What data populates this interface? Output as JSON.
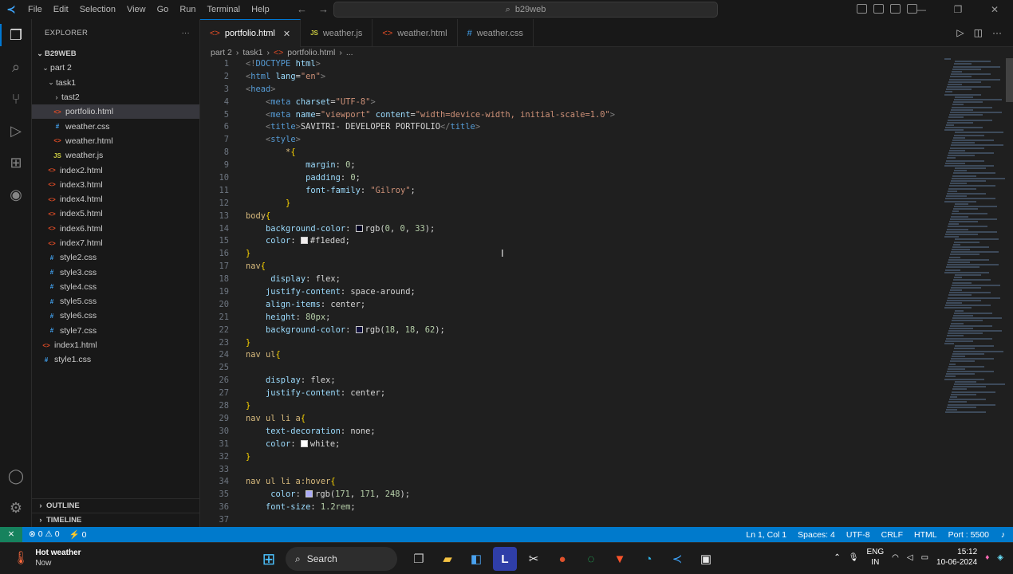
{
  "titlebar": {
    "menu": [
      "File",
      "Edit",
      "Selection",
      "View",
      "Go",
      "Run",
      "Terminal",
      "Help"
    ],
    "search": "b29web"
  },
  "explorer": {
    "title": "EXPLORER",
    "root": "B29WEB",
    "items": [
      {
        "label": "part 2",
        "depth": 1,
        "kind": "folder",
        "open": true
      },
      {
        "label": "task1",
        "depth": 2,
        "kind": "folder",
        "open": true
      },
      {
        "label": "tast2",
        "depth": 3,
        "kind": "folder",
        "open": false
      },
      {
        "label": "portfolio.html",
        "depth": 3,
        "kind": "html",
        "selected": true
      },
      {
        "label": "weather.css",
        "depth": 3,
        "kind": "css"
      },
      {
        "label": "weather.html",
        "depth": 3,
        "kind": "html"
      },
      {
        "label": "weather.js",
        "depth": 3,
        "kind": "js"
      },
      {
        "label": "index2.html",
        "depth": 2,
        "kind": "html"
      },
      {
        "label": "index3.html",
        "depth": 2,
        "kind": "html"
      },
      {
        "label": "index4.html",
        "depth": 2,
        "kind": "html"
      },
      {
        "label": "index5.html",
        "depth": 2,
        "kind": "html"
      },
      {
        "label": "index6.html",
        "depth": 2,
        "kind": "html"
      },
      {
        "label": "index7.html",
        "depth": 2,
        "kind": "html"
      },
      {
        "label": "style2.css",
        "depth": 2,
        "kind": "css"
      },
      {
        "label": "style3.css",
        "depth": 2,
        "kind": "css"
      },
      {
        "label": "style4.css",
        "depth": 2,
        "kind": "css"
      },
      {
        "label": "style5.css",
        "depth": 2,
        "kind": "css"
      },
      {
        "label": "style6.css",
        "depth": 2,
        "kind": "css"
      },
      {
        "label": "style7.css",
        "depth": 2,
        "kind": "css"
      },
      {
        "label": "index1.html",
        "depth": 1,
        "kind": "html"
      },
      {
        "label": "style1.css",
        "depth": 1,
        "kind": "css"
      }
    ],
    "outline": "OUTLINE",
    "timeline": "TIMELINE"
  },
  "tabs": [
    {
      "label": "portfolio.html",
      "kind": "html",
      "active": true
    },
    {
      "label": "weather.js",
      "kind": "js"
    },
    {
      "label": "weather.html",
      "kind": "html"
    },
    {
      "label": "weather.css",
      "kind": "css"
    }
  ],
  "breadcrumb": [
    "part 2",
    "task1",
    "portfolio.html",
    "..."
  ],
  "code": [
    [
      [
        "t-punc",
        "<!"
      ],
      [
        "t-tag",
        "DOCTYPE "
      ],
      [
        "t-attr",
        "html"
      ],
      [
        "t-punc",
        ">"
      ]
    ],
    [
      [
        "t-punc",
        "<"
      ],
      [
        "t-tag",
        "html "
      ],
      [
        "t-attr",
        "lang"
      ],
      [
        "t-txt",
        "="
      ],
      [
        "t-str",
        "\"en\""
      ],
      [
        "t-punc",
        ">"
      ]
    ],
    [
      [
        "t-punc",
        "<"
      ],
      [
        "t-tag",
        "head"
      ],
      [
        "t-punc",
        ">"
      ]
    ],
    [
      [
        "t-txt",
        "    "
      ],
      [
        "t-punc",
        "<"
      ],
      [
        "t-tag",
        "meta "
      ],
      [
        "t-attr",
        "charset"
      ],
      [
        "t-txt",
        "="
      ],
      [
        "t-str",
        "\"UTF-8\""
      ],
      [
        "t-punc",
        ">"
      ]
    ],
    [
      [
        "t-txt",
        "    "
      ],
      [
        "t-punc",
        "<"
      ],
      [
        "t-tag",
        "meta "
      ],
      [
        "t-attr",
        "name"
      ],
      [
        "t-txt",
        "="
      ],
      [
        "t-str",
        "\"viewport\" "
      ],
      [
        "t-attr",
        "content"
      ],
      [
        "t-txt",
        "="
      ],
      [
        "t-str",
        "\"width=device-width, initial-scale=1.0\""
      ],
      [
        "t-punc",
        ">"
      ]
    ],
    [
      [
        "t-txt",
        "    "
      ],
      [
        "t-punc",
        "<"
      ],
      [
        "t-tag",
        "title"
      ],
      [
        "t-punc",
        ">"
      ],
      [
        "t-txt",
        "SAVITRI- DEVELOPER PORTFOLIO"
      ],
      [
        "t-punc",
        "</"
      ],
      [
        "t-tag",
        "title"
      ],
      [
        "t-punc",
        ">"
      ]
    ],
    [
      [
        "t-txt",
        "    "
      ],
      [
        "t-punc",
        "<"
      ],
      [
        "t-tag",
        "style"
      ],
      [
        "t-punc",
        ">"
      ]
    ],
    [
      [
        "t-txt",
        "        "
      ],
      [
        "t-sel",
        "*"
      ],
      [
        "t-brk",
        "{"
      ]
    ],
    [
      [
        "t-txt",
        "            "
      ],
      [
        "t-prop",
        "margin"
      ],
      [
        "t-txt",
        ": "
      ],
      [
        "t-num",
        "0"
      ],
      [
        "t-txt",
        ";"
      ]
    ],
    [
      [
        "t-txt",
        "            "
      ],
      [
        "t-prop",
        "padding"
      ],
      [
        "t-txt",
        ": "
      ],
      [
        "t-num",
        "0"
      ],
      [
        "t-txt",
        ";"
      ]
    ],
    [
      [
        "t-txt",
        "            "
      ],
      [
        "t-prop",
        "font-family"
      ],
      [
        "t-txt",
        ": "
      ],
      [
        "t-val",
        "\"Gilroy\""
      ],
      [
        "t-txt",
        ";"
      ]
    ],
    [
      [
        "t-txt",
        "        "
      ],
      [
        "t-brk",
        "}"
      ]
    ],
    [
      [
        "t-sel",
        "body"
      ],
      [
        "t-brk",
        "{"
      ]
    ],
    [
      [
        "t-txt",
        "    "
      ],
      [
        "t-prop",
        "background-color"
      ],
      [
        "t-txt",
        ": "
      ],
      [
        "sw",
        "#000021"
      ],
      [
        "t-txt",
        "rgb("
      ],
      [
        "t-num",
        "0"
      ],
      [
        "t-txt",
        ", "
      ],
      [
        "t-num",
        "0"
      ],
      [
        "t-txt",
        ", "
      ],
      [
        "t-num",
        "33"
      ],
      [
        "t-txt",
        ");"
      ]
    ],
    [
      [
        "t-txt",
        "    "
      ],
      [
        "t-prop",
        "color"
      ],
      [
        "t-txt",
        ": "
      ],
      [
        "sw",
        "#f1eded"
      ],
      [
        "t-txt",
        "#f1eded;"
      ]
    ],
    [
      [
        "t-brk",
        "}"
      ]
    ],
    [
      [
        "t-sel",
        "nav"
      ],
      [
        "t-brk",
        "{"
      ]
    ],
    [
      [
        "t-txt",
        "     "
      ],
      [
        "t-prop",
        "display"
      ],
      [
        "t-txt",
        ": "
      ],
      [
        "t-txt",
        "flex;"
      ]
    ],
    [
      [
        "t-txt",
        "    "
      ],
      [
        "t-prop",
        "justify-content"
      ],
      [
        "t-txt",
        ": "
      ],
      [
        "t-txt",
        "space-around;"
      ]
    ],
    [
      [
        "t-txt",
        "    "
      ],
      [
        "t-prop",
        "align-items"
      ],
      [
        "t-txt",
        ": "
      ],
      [
        "t-txt",
        "center;"
      ]
    ],
    [
      [
        "t-txt",
        "    "
      ],
      [
        "t-prop",
        "height"
      ],
      [
        "t-txt",
        ": "
      ],
      [
        "t-num",
        "80px"
      ],
      [
        "t-txt",
        ";"
      ]
    ],
    [
      [
        "t-txt",
        "    "
      ],
      [
        "t-prop",
        "background-color"
      ],
      [
        "t-txt",
        ": "
      ],
      [
        "sw",
        "#12123e"
      ],
      [
        "t-txt",
        "rgb("
      ],
      [
        "t-num",
        "18"
      ],
      [
        "t-txt",
        ", "
      ],
      [
        "t-num",
        "18"
      ],
      [
        "t-txt",
        ", "
      ],
      [
        "t-num",
        "62"
      ],
      [
        "t-txt",
        ");"
      ]
    ],
    [
      [
        "t-brk",
        "}"
      ]
    ],
    [
      [
        "t-sel",
        "nav ul"
      ],
      [
        "t-brk",
        "{"
      ]
    ],
    [
      [
        "t-txt",
        ""
      ]
    ],
    [
      [
        "t-txt",
        "    "
      ],
      [
        "t-prop",
        "display"
      ],
      [
        "t-txt",
        ": "
      ],
      [
        "t-txt",
        "flex;"
      ]
    ],
    [
      [
        "t-txt",
        "    "
      ],
      [
        "t-prop",
        "justify-content"
      ],
      [
        "t-txt",
        ": "
      ],
      [
        "t-txt",
        "center;"
      ]
    ],
    [
      [
        "t-brk",
        "}"
      ]
    ],
    [
      [
        "t-sel",
        "nav ul li a"
      ],
      [
        "t-brk",
        "{"
      ]
    ],
    [
      [
        "t-txt",
        "    "
      ],
      [
        "t-prop",
        "text-decoration"
      ],
      [
        "t-txt",
        ": "
      ],
      [
        "t-txt",
        "none;"
      ]
    ],
    [
      [
        "t-txt",
        "    "
      ],
      [
        "t-prop",
        "color"
      ],
      [
        "t-txt",
        ": "
      ],
      [
        "sw",
        "#ffffff"
      ],
      [
        "t-txt",
        "white;"
      ]
    ],
    [
      [
        "t-brk",
        "}"
      ]
    ],
    [
      [
        "t-txt",
        ""
      ]
    ],
    [
      [
        "t-sel",
        "nav ul li a:hover"
      ],
      [
        "t-brk",
        "{"
      ]
    ],
    [
      [
        "t-txt",
        "     "
      ],
      [
        "t-prop",
        "color"
      ],
      [
        "t-txt",
        ": "
      ],
      [
        "sw",
        "#ababf8"
      ],
      [
        "t-txt",
        "rgb("
      ],
      [
        "t-num",
        "171"
      ],
      [
        "t-txt",
        ", "
      ],
      [
        "t-num",
        "171"
      ],
      [
        "t-txt",
        ", "
      ],
      [
        "t-num",
        "248"
      ],
      [
        "t-txt",
        ");"
      ]
    ],
    [
      [
        "t-txt",
        "    "
      ],
      [
        "t-prop",
        "font-size"
      ],
      [
        "t-txt",
        ": "
      ],
      [
        "t-num",
        "1.2rem"
      ],
      [
        "t-txt",
        ";"
      ]
    ],
    [
      [
        "t-txt",
        ""
      ]
    ]
  ],
  "statusbar": {
    "problems": "⊗ 0 ⚠ 0",
    "ports": "⚡ 0",
    "position": "Ln 1, Col 1",
    "spaces": "Spaces: 4",
    "encoding": "UTF-8",
    "eol": "CRLF",
    "language": "HTML",
    "port": "Port : 5500"
  },
  "taskbar": {
    "weather_title": "Hot weather",
    "weather_sub": "Now",
    "search": "Search",
    "lang_top": "ENG",
    "lang_bottom": "IN",
    "time": "15:12",
    "date": "10-06-2024"
  }
}
